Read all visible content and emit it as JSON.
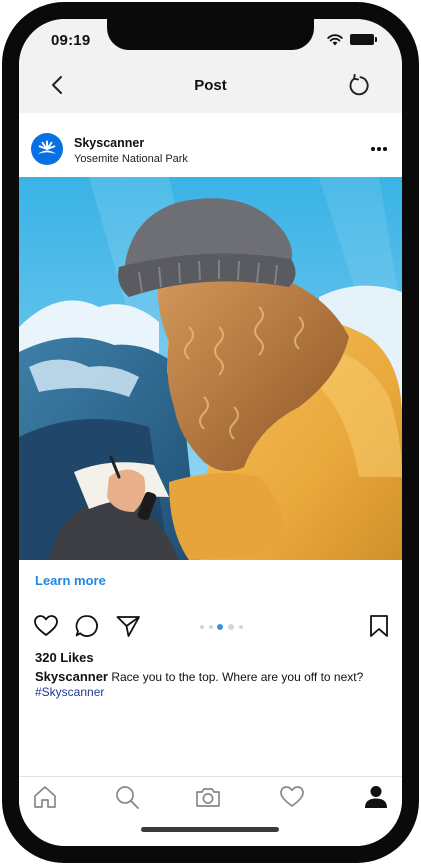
{
  "status_bar": {
    "time": "09:19"
  },
  "nav": {
    "title": "Post",
    "back_icon": "chevron-left-icon",
    "refresh_icon": "refresh-icon"
  },
  "post": {
    "account_name": "Skyscanner",
    "location": "Yosemite National Park",
    "cta_label": "Learn more",
    "likes": "320 Likes",
    "caption_user": "Skyscanner",
    "caption_text": "Race you to the top. Where are you off to next?",
    "hashtag": "#Skyscanner",
    "carousel": {
      "count": 5,
      "active_index": 2
    }
  },
  "actions": [
    "heart-icon",
    "comment-icon",
    "share-icon",
    "bookmark-icon"
  ],
  "tabbar": [
    "home-icon",
    "search-icon",
    "camera-icon",
    "activity-heart-icon",
    "profile-icon"
  ],
  "colors": {
    "link": "#1e88e5",
    "hashtag": "#1f3a93",
    "brand": "#0770e3",
    "active_dot": "#3b8fe8"
  }
}
